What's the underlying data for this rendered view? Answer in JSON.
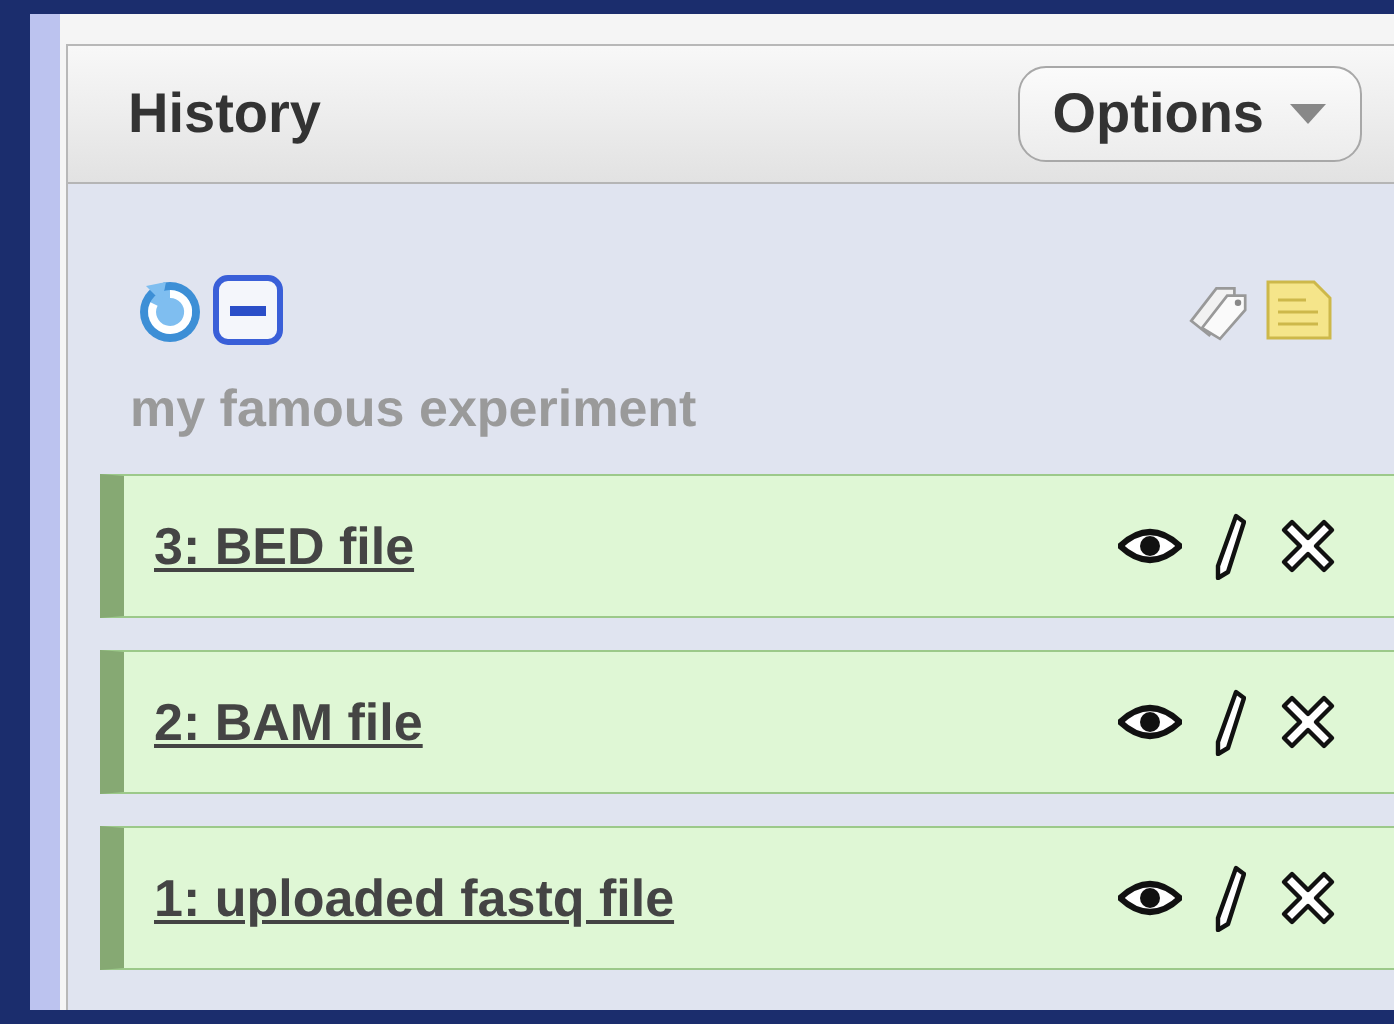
{
  "panel": {
    "title": "History",
    "options_button": "Options"
  },
  "history": {
    "name": "my famous experiment"
  },
  "datasets": [
    {
      "label": "3: BED file"
    },
    {
      "label": "2: BAM file"
    },
    {
      "label": "1: uploaded fastq file"
    }
  ]
}
